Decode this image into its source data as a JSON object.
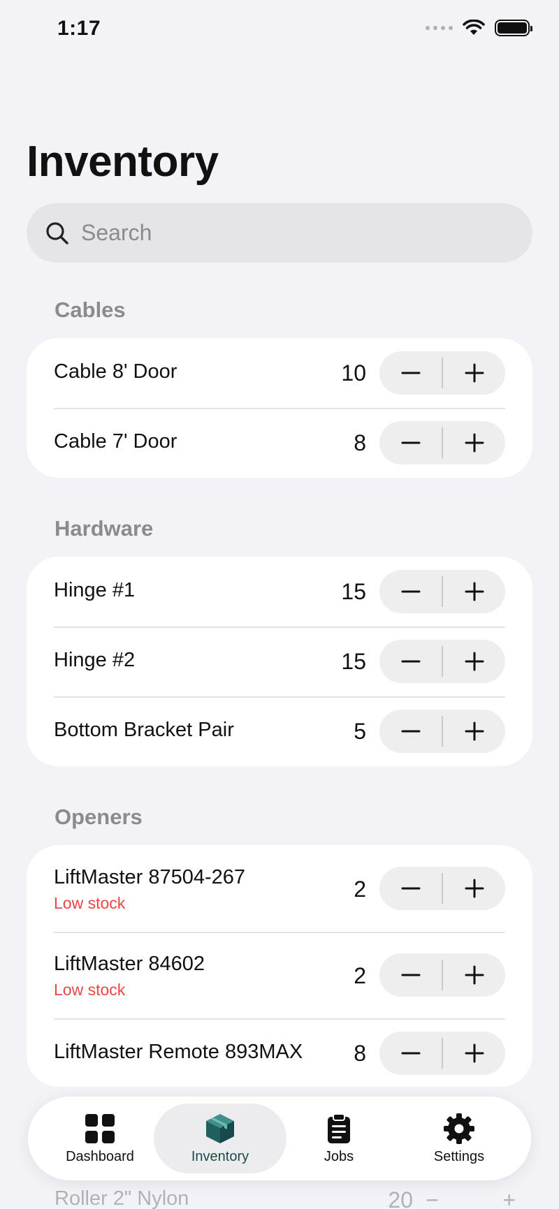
{
  "status_bar": {
    "time": "1:17"
  },
  "page": {
    "title": "Inventory"
  },
  "search": {
    "placeholder": "Search"
  },
  "sections": [
    {
      "title": "Cables",
      "items": [
        {
          "name": "Cable 8' Door",
          "qty": "10"
        },
        {
          "name": "Cable 7' Door",
          "qty": "8"
        }
      ]
    },
    {
      "title": "Hardware",
      "items": [
        {
          "name": "Hinge #1",
          "qty": "15"
        },
        {
          "name": "Hinge #2",
          "qty": "15"
        },
        {
          "name": "Bottom Bracket Pair",
          "qty": "5"
        }
      ]
    },
    {
      "title": "Openers",
      "items": [
        {
          "name": "LiftMaster 87504-267",
          "qty": "2",
          "warning": "Low stock"
        },
        {
          "name": "LiftMaster 84602",
          "qty": "2",
          "warning": "Low stock"
        },
        {
          "name": "LiftMaster Remote 893MAX",
          "qty": "8"
        }
      ]
    }
  ],
  "partial_row": {
    "name": "Roller 2\" Nylon",
    "qty": "20",
    "minus": "−",
    "plus": "+"
  },
  "tab_bar": {
    "active": "inventory",
    "tabs": [
      {
        "id": "dashboard",
        "label": "Dashboard",
        "icon": "grid-icon"
      },
      {
        "id": "inventory",
        "label": "Inventory",
        "icon": "box-icon"
      },
      {
        "id": "jobs",
        "label": "Jobs",
        "icon": "clipboard-icon"
      },
      {
        "id": "settings",
        "label": "Settings",
        "icon": "gear-icon"
      }
    ]
  },
  "colors": {
    "accent": "#1f4a49",
    "warning": "#ef4444",
    "background": "#f2f2f7"
  }
}
